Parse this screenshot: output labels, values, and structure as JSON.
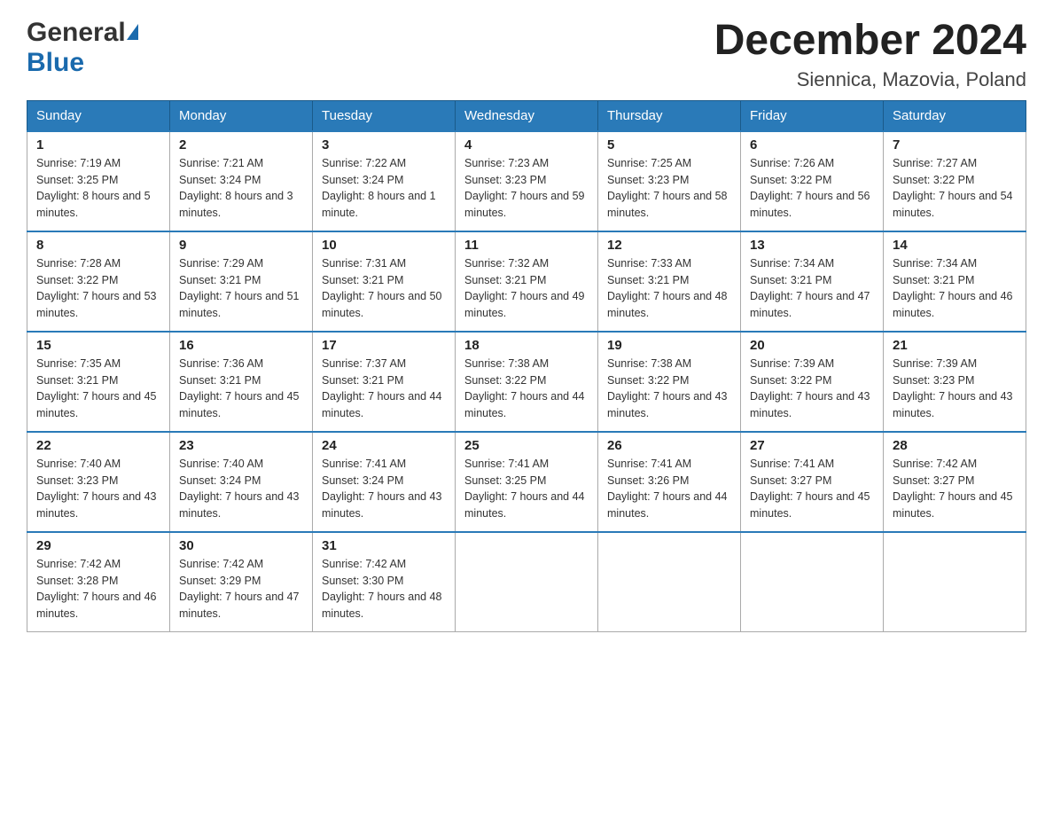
{
  "header": {
    "logo_general": "General",
    "logo_blue": "Blue",
    "month_title": "December 2024",
    "location": "Siennica, Mazovia, Poland"
  },
  "days_of_week": [
    "Sunday",
    "Monday",
    "Tuesday",
    "Wednesday",
    "Thursday",
    "Friday",
    "Saturday"
  ],
  "weeks": [
    [
      {
        "day": "1",
        "sunrise": "7:19 AM",
        "sunset": "3:25 PM",
        "daylight": "8 hours and 5 minutes."
      },
      {
        "day": "2",
        "sunrise": "7:21 AM",
        "sunset": "3:24 PM",
        "daylight": "8 hours and 3 minutes."
      },
      {
        "day": "3",
        "sunrise": "7:22 AM",
        "sunset": "3:24 PM",
        "daylight": "8 hours and 1 minute."
      },
      {
        "day": "4",
        "sunrise": "7:23 AM",
        "sunset": "3:23 PM",
        "daylight": "7 hours and 59 minutes."
      },
      {
        "day": "5",
        "sunrise": "7:25 AM",
        "sunset": "3:23 PM",
        "daylight": "7 hours and 58 minutes."
      },
      {
        "day": "6",
        "sunrise": "7:26 AM",
        "sunset": "3:22 PM",
        "daylight": "7 hours and 56 minutes."
      },
      {
        "day": "7",
        "sunrise": "7:27 AM",
        "sunset": "3:22 PM",
        "daylight": "7 hours and 54 minutes."
      }
    ],
    [
      {
        "day": "8",
        "sunrise": "7:28 AM",
        "sunset": "3:22 PM",
        "daylight": "7 hours and 53 minutes."
      },
      {
        "day": "9",
        "sunrise": "7:29 AM",
        "sunset": "3:21 PM",
        "daylight": "7 hours and 51 minutes."
      },
      {
        "day": "10",
        "sunrise": "7:31 AM",
        "sunset": "3:21 PM",
        "daylight": "7 hours and 50 minutes."
      },
      {
        "day": "11",
        "sunrise": "7:32 AM",
        "sunset": "3:21 PM",
        "daylight": "7 hours and 49 minutes."
      },
      {
        "day": "12",
        "sunrise": "7:33 AM",
        "sunset": "3:21 PM",
        "daylight": "7 hours and 48 minutes."
      },
      {
        "day": "13",
        "sunrise": "7:34 AM",
        "sunset": "3:21 PM",
        "daylight": "7 hours and 47 minutes."
      },
      {
        "day": "14",
        "sunrise": "7:34 AM",
        "sunset": "3:21 PM",
        "daylight": "7 hours and 46 minutes."
      }
    ],
    [
      {
        "day": "15",
        "sunrise": "7:35 AM",
        "sunset": "3:21 PM",
        "daylight": "7 hours and 45 minutes."
      },
      {
        "day": "16",
        "sunrise": "7:36 AM",
        "sunset": "3:21 PM",
        "daylight": "7 hours and 45 minutes."
      },
      {
        "day": "17",
        "sunrise": "7:37 AM",
        "sunset": "3:21 PM",
        "daylight": "7 hours and 44 minutes."
      },
      {
        "day": "18",
        "sunrise": "7:38 AM",
        "sunset": "3:22 PM",
        "daylight": "7 hours and 44 minutes."
      },
      {
        "day": "19",
        "sunrise": "7:38 AM",
        "sunset": "3:22 PM",
        "daylight": "7 hours and 43 minutes."
      },
      {
        "day": "20",
        "sunrise": "7:39 AM",
        "sunset": "3:22 PM",
        "daylight": "7 hours and 43 minutes."
      },
      {
        "day": "21",
        "sunrise": "7:39 AM",
        "sunset": "3:23 PM",
        "daylight": "7 hours and 43 minutes."
      }
    ],
    [
      {
        "day": "22",
        "sunrise": "7:40 AM",
        "sunset": "3:23 PM",
        "daylight": "7 hours and 43 minutes."
      },
      {
        "day": "23",
        "sunrise": "7:40 AM",
        "sunset": "3:24 PM",
        "daylight": "7 hours and 43 minutes."
      },
      {
        "day": "24",
        "sunrise": "7:41 AM",
        "sunset": "3:24 PM",
        "daylight": "7 hours and 43 minutes."
      },
      {
        "day": "25",
        "sunrise": "7:41 AM",
        "sunset": "3:25 PM",
        "daylight": "7 hours and 44 minutes."
      },
      {
        "day": "26",
        "sunrise": "7:41 AM",
        "sunset": "3:26 PM",
        "daylight": "7 hours and 44 minutes."
      },
      {
        "day": "27",
        "sunrise": "7:41 AM",
        "sunset": "3:27 PM",
        "daylight": "7 hours and 45 minutes."
      },
      {
        "day": "28",
        "sunrise": "7:42 AM",
        "sunset": "3:27 PM",
        "daylight": "7 hours and 45 minutes."
      }
    ],
    [
      {
        "day": "29",
        "sunrise": "7:42 AM",
        "sunset": "3:28 PM",
        "daylight": "7 hours and 46 minutes."
      },
      {
        "day": "30",
        "sunrise": "7:42 AM",
        "sunset": "3:29 PM",
        "daylight": "7 hours and 47 minutes."
      },
      {
        "day": "31",
        "sunrise": "7:42 AM",
        "sunset": "3:30 PM",
        "daylight": "7 hours and 48 minutes."
      },
      null,
      null,
      null,
      null
    ]
  ],
  "labels": {
    "sunrise_prefix": "Sunrise: ",
    "sunset_prefix": "Sunset: ",
    "daylight_prefix": "Daylight: "
  }
}
